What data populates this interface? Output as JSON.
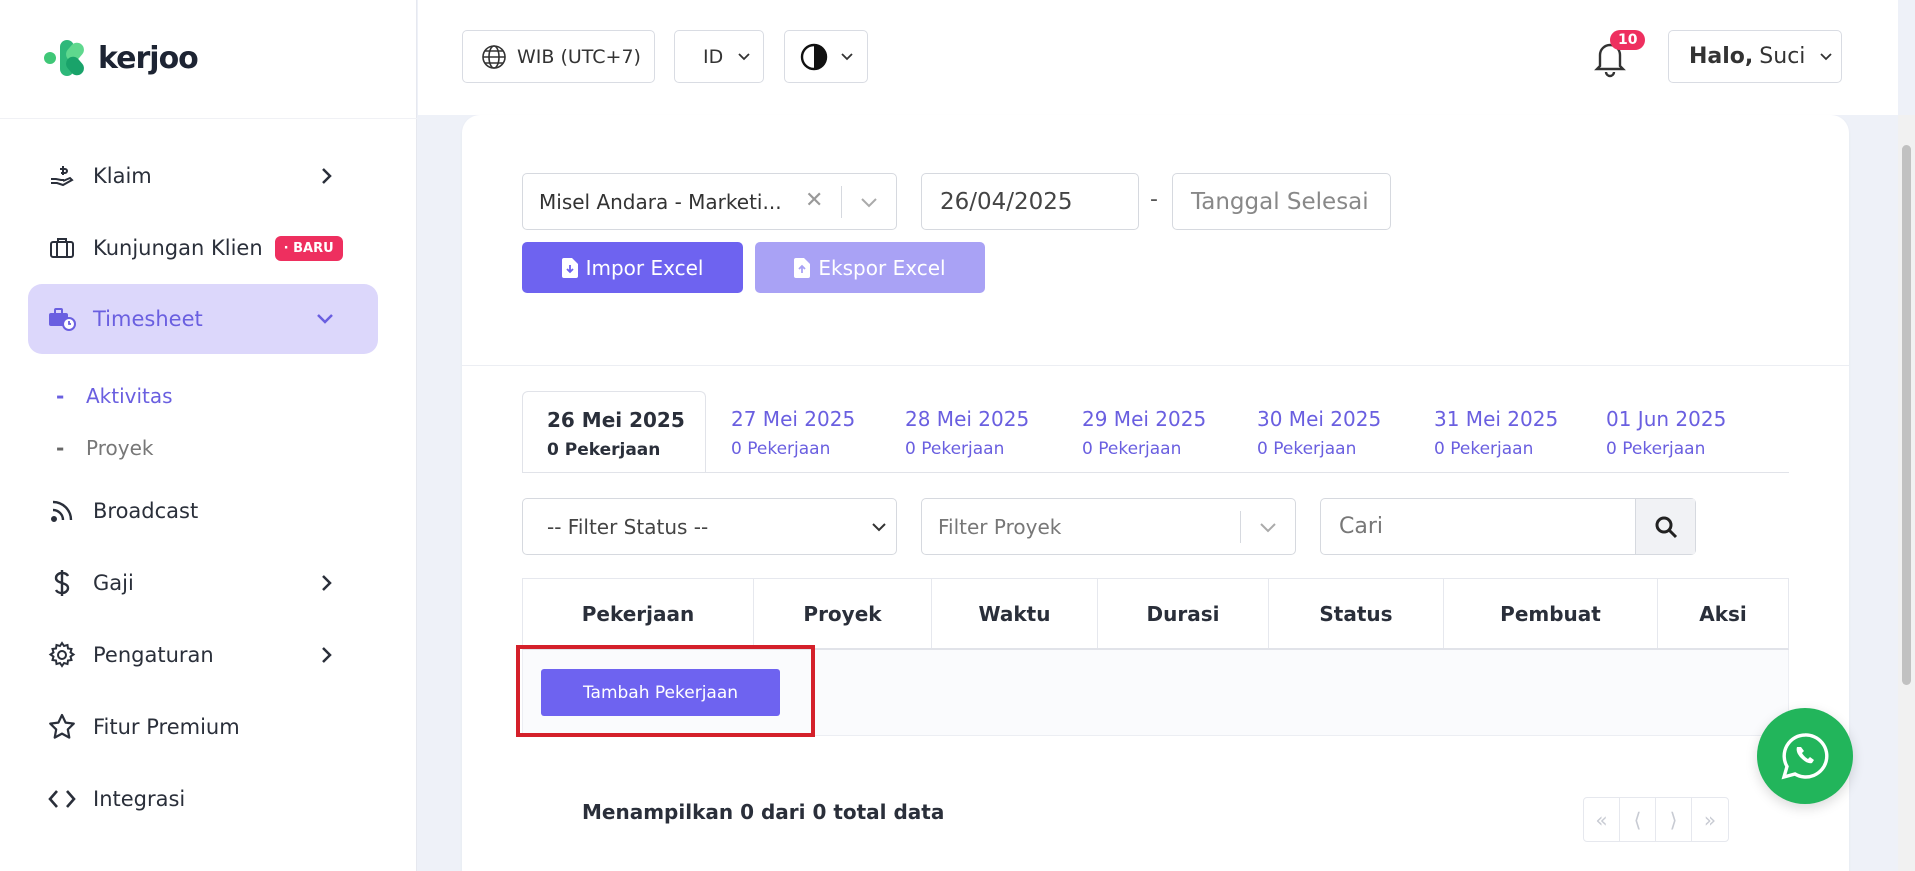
{
  "brand": {
    "name": "kerjoo"
  },
  "sidebar": {
    "items": [
      {
        "label": "Klaim",
        "icon": "hand-money-icon",
        "has_chevron": true
      },
      {
        "label": "Kunjungan Klien",
        "icon": "briefcase-icon",
        "badge": "· BARU"
      },
      {
        "label": "Timesheet",
        "icon": "timesheet-icon",
        "expanded": true
      },
      {
        "label": "Broadcast",
        "icon": "rss-icon"
      },
      {
        "label": "Gaji",
        "icon": "dollar-icon",
        "has_chevron": true
      },
      {
        "label": "Pengaturan",
        "icon": "gear-icon",
        "has_chevron": true
      },
      {
        "label": "Fitur Premium",
        "icon": "star-icon"
      },
      {
        "label": "Integrasi",
        "icon": "code-icon"
      }
    ],
    "sub_items": [
      {
        "label": "Aktivitas",
        "active": true
      },
      {
        "label": "Proyek",
        "active": false
      }
    ]
  },
  "topbar": {
    "timezone": "WIB (UTC+7)",
    "language": "ID",
    "notification_count": "10",
    "greeting_bold": "Halo,",
    "greeting_name": "Suci"
  },
  "filters": {
    "employee": "Misel Andara - Marketi...",
    "start_date": "26/04/2025",
    "range_sep": "-",
    "end_date_placeholder": "Tanggal Selesai",
    "import_label": "Impor Excel",
    "export_label": "Ekspor Excel"
  },
  "tabs": [
    {
      "date": "26 Mei 2025",
      "count": "0 Pekerjaan",
      "active": true
    },
    {
      "date": "27 Mei 2025",
      "count": "0 Pekerjaan"
    },
    {
      "date": "28 Mei 2025",
      "count": "0 Pekerjaan"
    },
    {
      "date": "29 Mei 2025",
      "count": "0 Pekerjaan"
    },
    {
      "date": "30 Mei 2025",
      "count": "0 Pekerjaan"
    },
    {
      "date": "31 Mei 2025",
      "count": "0 Pekerjaan"
    },
    {
      "date": "01 Jun 2025",
      "count": "0 Pekerjaan"
    }
  ],
  "table_filters": {
    "status_placeholder": "-- Filter Status --",
    "project_placeholder": "Filter Proyek",
    "search_placeholder": "Cari"
  },
  "table": {
    "columns": [
      "Pekerjaan",
      "Proyek",
      "Waktu",
      "Durasi",
      "Status",
      "Pembuat",
      "Aksi"
    ],
    "add_button": "Tambah Pekerjaan",
    "summary": "Menampilkan 0 dari 0 total data"
  },
  "pager": [
    "«",
    "⟨",
    "⟩",
    "»"
  ],
  "colors": {
    "accent": "#6e63f0",
    "accent_light": "#dcd7fb",
    "badge": "#ee2f5f",
    "whatsapp": "#22b55b",
    "highlight": "#d4202a"
  }
}
